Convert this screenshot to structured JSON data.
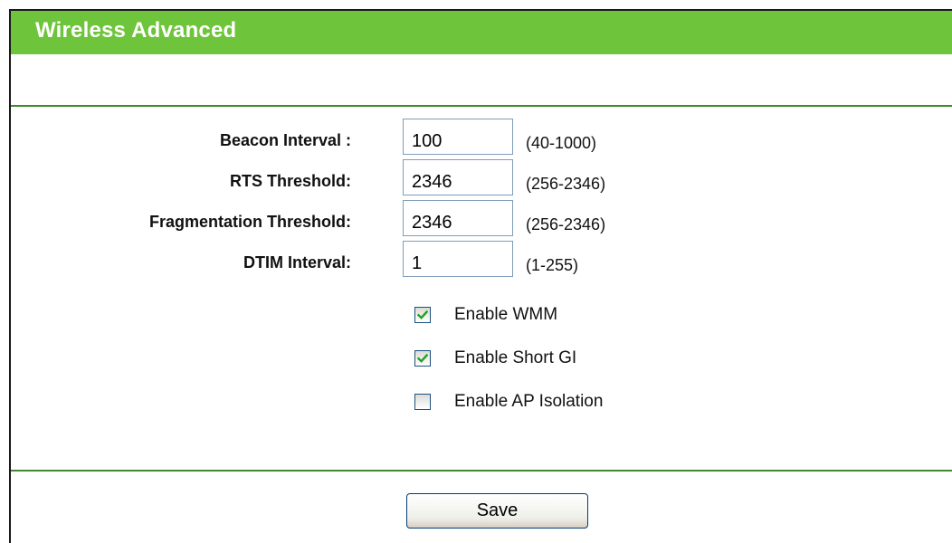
{
  "header": {
    "title": "Wireless Advanced"
  },
  "fields": [
    {
      "label": "Beacon Interval :",
      "value": "100",
      "range": "(40-1000)"
    },
    {
      "label": "RTS Threshold:",
      "value": "2346",
      "range": "(256-2346)"
    },
    {
      "label": "Fragmentation Threshold:",
      "value": "2346",
      "range": "(256-2346)"
    },
    {
      "label": "DTIM Interval:",
      "value": "1",
      "range": "(1-255)"
    }
  ],
  "options": [
    {
      "label": "Enable WMM",
      "checked": true
    },
    {
      "label": "Enable Short GI",
      "checked": true
    },
    {
      "label": "Enable AP Isolation",
      "checked": false
    }
  ],
  "actions": {
    "save_label": "Save"
  },
  "colors": {
    "header_bg": "#6ec43a",
    "divider": "#3f8a2f",
    "check_mark": "#21a121"
  }
}
